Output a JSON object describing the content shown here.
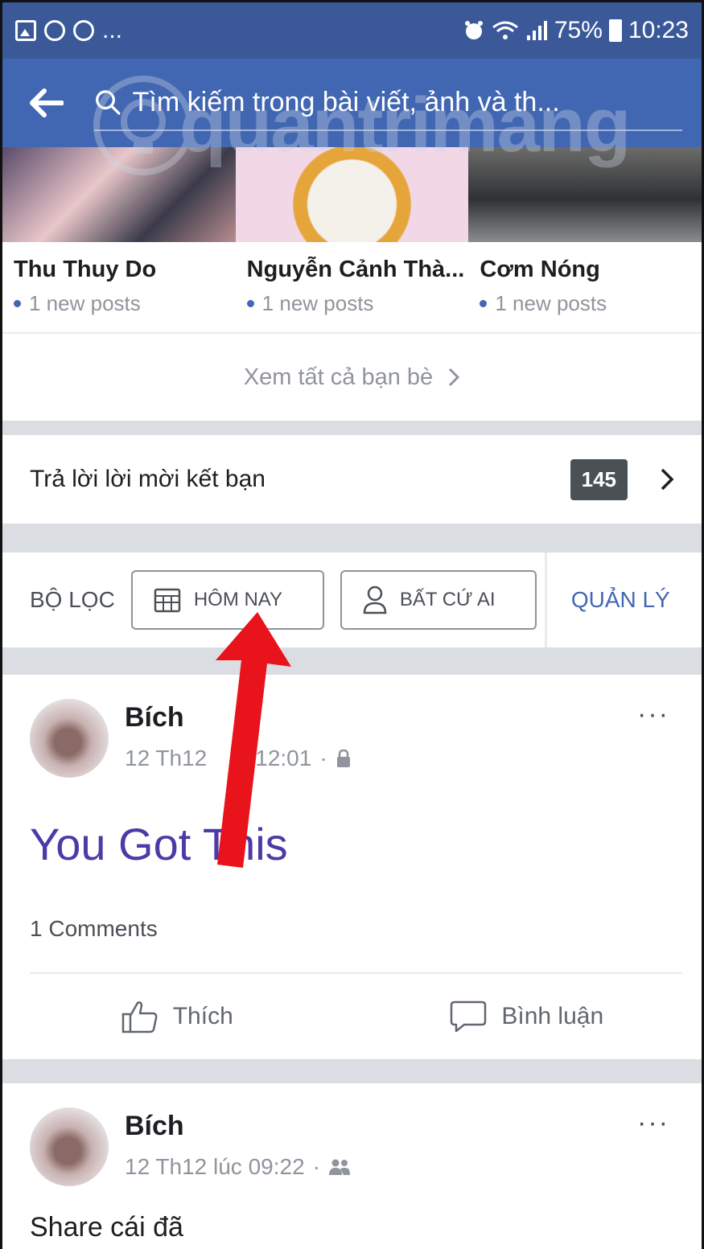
{
  "status_bar": {
    "left_more": "...",
    "battery": "75%",
    "time": "10:23"
  },
  "search": {
    "placeholder": "Tìm kiếm trong bài viết, ảnh và th..."
  },
  "watermark": "quantrimang",
  "friends": [
    {
      "name": "Thu Thuy Do",
      "posts": "1 new posts"
    },
    {
      "name": "Nguyễn Cảnh Thà...",
      "posts": "1 new posts"
    },
    {
      "name": "Cơm Nóng",
      "posts": "1 new posts"
    }
  ],
  "see_all_label": "Xem tất cả bạn bè",
  "requests": {
    "label": "Trả lời lời mời kết bạn",
    "count": "145"
  },
  "filters": {
    "label": "BỘ LỌC",
    "chip_date": "HÔM NAY",
    "chip_people": "BẤT CỨ AI",
    "manage": "QUẢN LÝ"
  },
  "posts": [
    {
      "author": "Bích",
      "time_date": "12 Th12",
      "time_clock": "12:01",
      "privacy_icon": "lock-icon",
      "text": "You Got This",
      "comments": "1 Comments",
      "like_label": "Thích",
      "comment_label": "Bình luận"
    },
    {
      "author": "Bích",
      "time": "12 Th12 lúc 09:22",
      "privacy_icon": "friends-icon",
      "text": "Share cái đã"
    }
  ],
  "colors": {
    "brand": "#4267b2",
    "status_bar": "#3b5998",
    "big_text": "#4d3aa6",
    "arrow": "#e8131b"
  }
}
